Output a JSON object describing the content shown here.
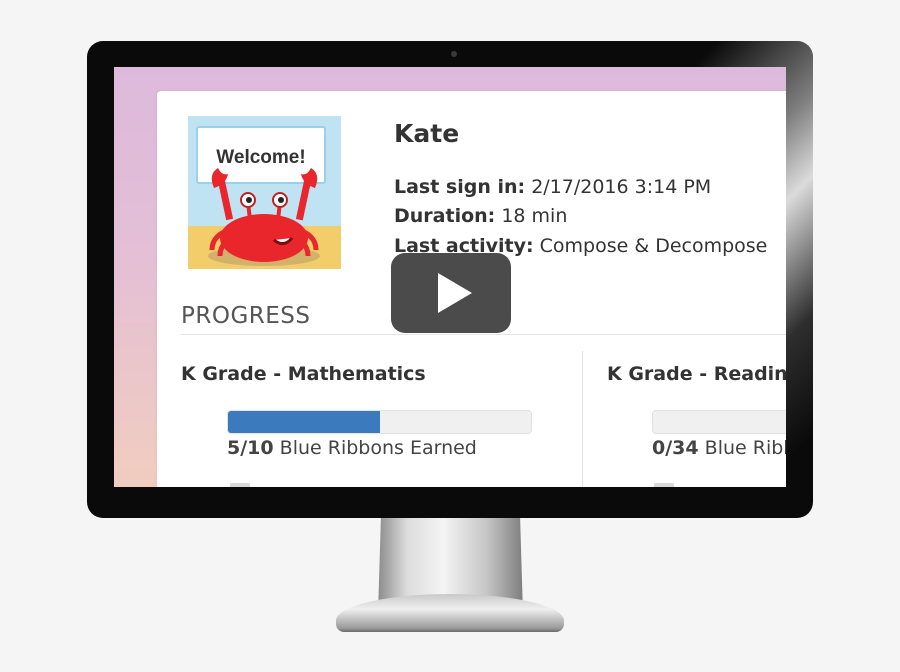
{
  "student": {
    "name": "Kate",
    "avatar": {
      "sign_text": "Welcome!"
    }
  },
  "session": {
    "last_sign_in_label": "Last sign in:",
    "last_sign_in_value": "2/17/2016 3:14 PM",
    "duration_label": "Duration:",
    "duration_value": "18 min",
    "last_activity_label": "Last activity:",
    "last_activity_value": "Compose & Decompose"
  },
  "progress": {
    "heading": "PROGRESS",
    "subjects": [
      {
        "title": "K Grade - Mathematics",
        "earned": "5/10",
        "ribbons_text": "Blue Ribbons Earned",
        "fill_fraction": 0.5
      },
      {
        "title": "K Grade - Reading",
        "earned": "0/34",
        "ribbons_text": "Blue Ribbons Earned",
        "fill_fraction": 0
      }
    ]
  },
  "video": {
    "play_icon": "play-icon"
  },
  "colors": {
    "progress_fill": "#3a7abd",
    "screen_gradient_top": "#ddb9dc",
    "screen_gradient_bottom": "#f1cdbf",
    "crab": "#e8262b"
  }
}
